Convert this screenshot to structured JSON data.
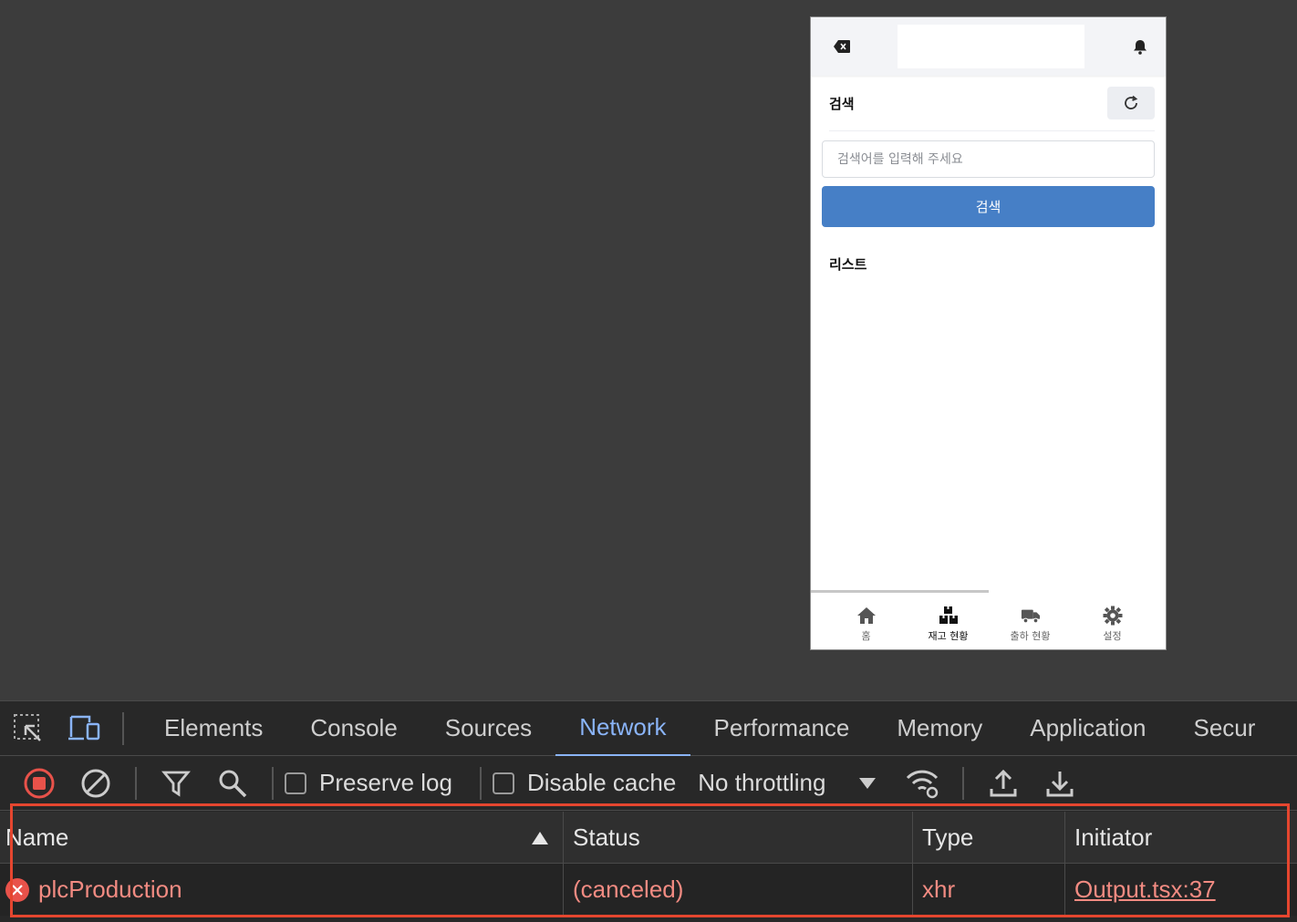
{
  "mobile": {
    "header": {
      "left_icon": "backspace-icon",
      "right_icon": "bell-icon"
    },
    "search_section": {
      "title": "검색",
      "refresh_icon": "refresh-icon",
      "placeholder": "검색어를 입력해 주세요",
      "value": "",
      "button_label": "검색"
    },
    "list_section": {
      "title": "리스트"
    },
    "bottom_nav": [
      {
        "label": "홈",
        "icon": "home-icon",
        "active": false
      },
      {
        "label": "재고 현황",
        "icon": "boxes-icon",
        "active": true
      },
      {
        "label": "출하 현황",
        "icon": "truck-icon",
        "active": false
      },
      {
        "label": "설정",
        "icon": "gear-icon",
        "active": false
      }
    ]
  },
  "devtools": {
    "tools": [
      "inspect-icon",
      "device-toggle-icon"
    ],
    "tabs": [
      "Elements",
      "Console",
      "Sources",
      "Network",
      "Performance",
      "Memory",
      "Application",
      "Secur"
    ],
    "active_tab": "Network",
    "toolbar": {
      "preserve_log": "Preserve log",
      "disable_cache": "Disable cache",
      "throttling": "No throttling"
    },
    "table": {
      "headers": [
        "Name",
        "Status",
        "Type",
        "Initiator"
      ],
      "rows": [
        {
          "name": "plcProduction",
          "status": "(canceled)",
          "type": "xhr",
          "initiator": "Output.tsx:37"
        }
      ]
    },
    "colors": {
      "accent": "#8ab4f8",
      "error": "#f28b82",
      "highlight": "#e5462f"
    }
  }
}
